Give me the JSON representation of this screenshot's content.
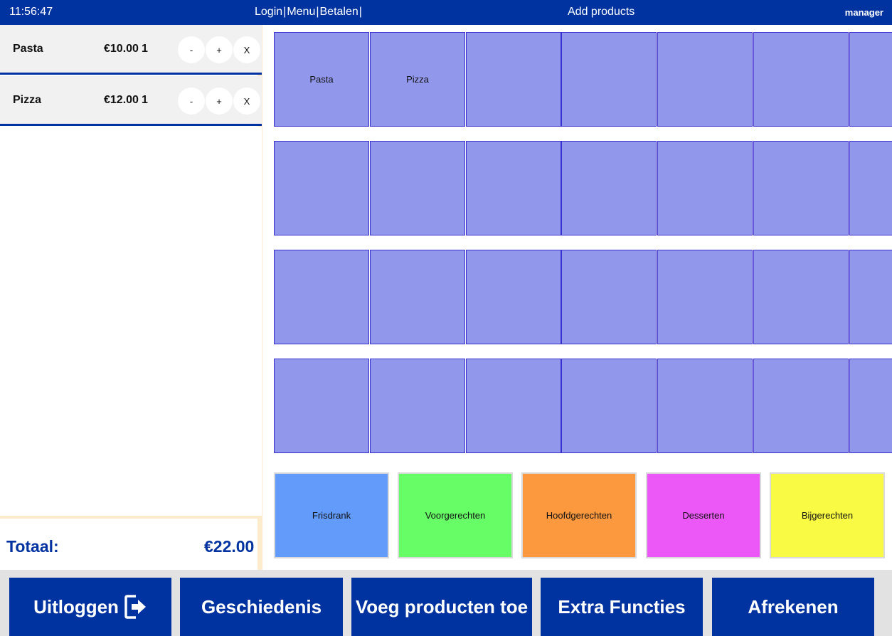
{
  "topbar": {
    "clock": "11:56:47",
    "nav": [
      "Login",
      "Menu",
      "Betalen"
    ],
    "nav_separator": "|",
    "page_title": "Add products",
    "user": "manager"
  },
  "order": {
    "items": [
      {
        "name": "Pasta",
        "price": "€10.00",
        "qty": "1",
        "minus": "-",
        "plus": "+",
        "remove": "X"
      },
      {
        "name": "Pizza",
        "price": "€12.00",
        "qty": "1",
        "minus": "-",
        "plus": "+",
        "remove": "X"
      }
    ],
    "total_label": "Totaal:",
    "total_value": "€22.00"
  },
  "products": {
    "row1": [
      "Pasta",
      "Pizza",
      "",
      "",
      "",
      "",
      ""
    ],
    "row2": [
      "",
      "",
      "",
      "",
      "",
      "",
      ""
    ],
    "row3": [
      "",
      "",
      "",
      "",
      "",
      "",
      ""
    ],
    "row4": [
      "",
      "",
      "",
      "",
      "",
      "",
      ""
    ],
    "tile_color": "#9198ec"
  },
  "categories": [
    {
      "label": "Frisdrank",
      "color": "#639bfa"
    },
    {
      "label": "Voorgerechten",
      "color": "#67fd67"
    },
    {
      "label": "Hoofdgerechten",
      "color": "#fc983e"
    },
    {
      "label": "Desserten",
      "color": "#eb58f7"
    },
    {
      "label": "Bijgerechten",
      "color": "#f9fa44"
    }
  ],
  "bottombar": {
    "logout": "Uitloggen",
    "history": "Geschiedenis",
    "add_products": "Voeg producten toe",
    "extra": "Extra Functies",
    "checkout": "Afrekenen"
  },
  "colors": {
    "brand": "#0033a0",
    "panel_border": "#fdeccb"
  }
}
